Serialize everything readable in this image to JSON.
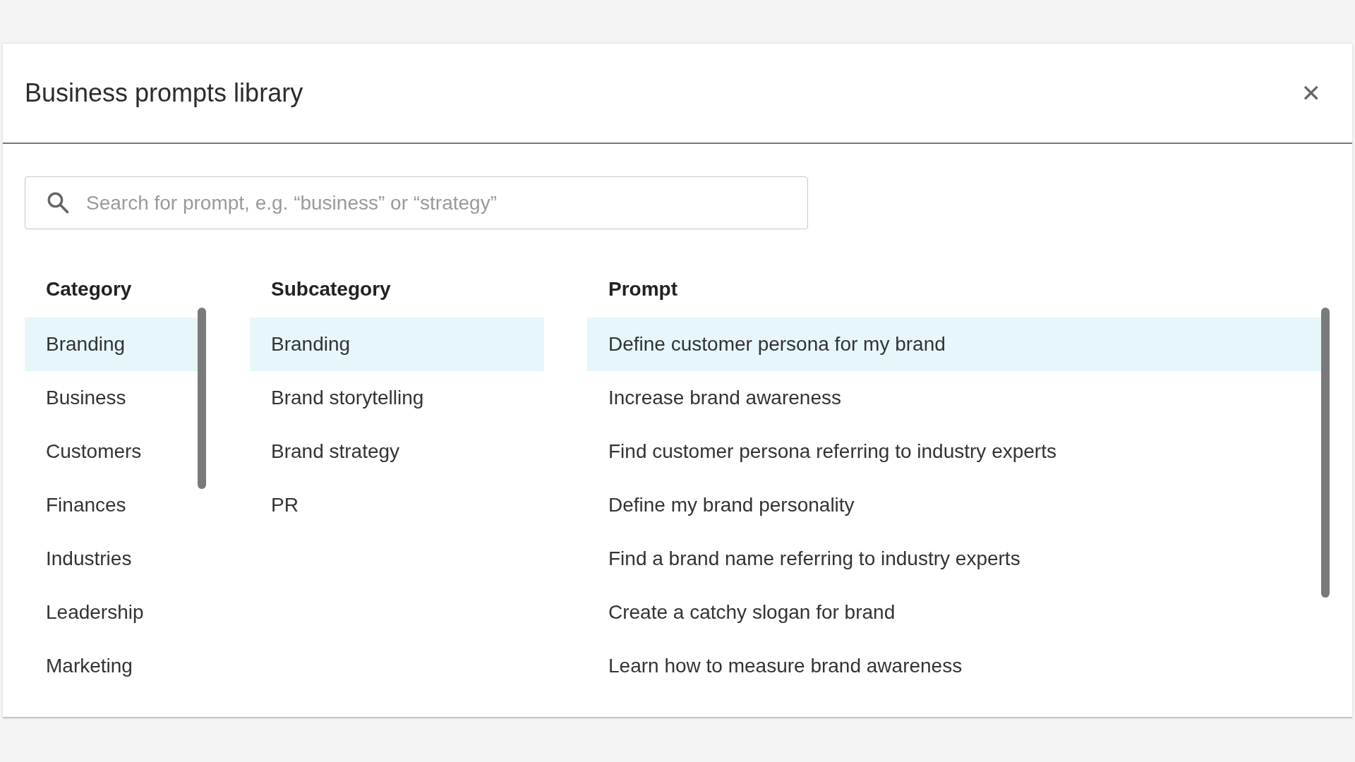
{
  "dialog": {
    "title": "Business prompts library",
    "close": "✕"
  },
  "search": {
    "placeholder": "Search for prompt, e.g. “business” or “strategy”"
  },
  "columns": [
    {
      "heading": "Category",
      "items": [
        {
          "label": "Branding",
          "selected": true
        },
        {
          "label": "Business",
          "selected": false
        },
        {
          "label": "Customers",
          "selected": false
        },
        {
          "label": "Finances",
          "selected": false
        },
        {
          "label": "Industries",
          "selected": false
        },
        {
          "label": "Leadership",
          "selected": false
        },
        {
          "label": "Marketing",
          "selected": false
        }
      ]
    },
    {
      "heading": "Subcategory",
      "items": [
        {
          "label": "Branding",
          "selected": true
        },
        {
          "label": "Brand storytelling",
          "selected": false
        },
        {
          "label": "Brand strategy",
          "selected": false
        },
        {
          "label": "PR",
          "selected": false
        }
      ]
    },
    {
      "heading": "Prompt",
      "items": [
        {
          "label": "Define customer persona for my brand",
          "selected": true
        },
        {
          "label": "Increase brand awareness",
          "selected": false
        },
        {
          "label": "Find customer persona referring to industry experts",
          "selected": false
        },
        {
          "label": "Define my brand personality",
          "selected": false
        },
        {
          "label": "Find a brand name referring to industry experts",
          "selected": false
        },
        {
          "label": "Create a catchy slogan for brand",
          "selected": false
        },
        {
          "label": "Learn how to measure brand awareness",
          "selected": false
        }
      ]
    }
  ]
}
